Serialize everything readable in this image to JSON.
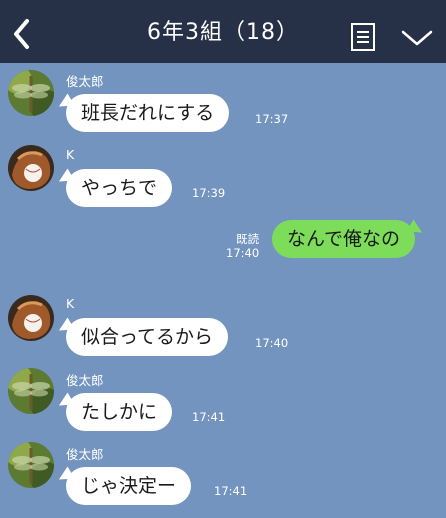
{
  "header": {
    "title": "6年3組（18）",
    "back_icon": "chevron-left-icon",
    "menu_icon": "notes-icon",
    "expand_icon": "chevron-down-icon",
    "background": "#263047"
  },
  "chat": {
    "background": "#7494c0",
    "outgoing_color": "#7ddd5a",
    "messages": [
      {
        "sender": "俊太郎",
        "text": "班長だれにする",
        "time": "17:37",
        "avatar": "dragonfly-avatar"
      },
      {
        "sender": "K",
        "text": "やっちで",
        "time": "17:39",
        "avatar": "baseball-glove-avatar"
      },
      {
        "read_label": "既読",
        "text": "なんで俺なの",
        "time": "17:40",
        "outgoing": true
      },
      {
        "sender": "K",
        "text": "似合ってるから",
        "time": "17:40",
        "avatar": "baseball-glove-avatar"
      },
      {
        "sender": "俊太郎",
        "text": "たしかに",
        "time": "17:41",
        "avatar": "dragonfly-avatar"
      },
      {
        "sender": "俊太郎",
        "text": "じゃ決定ー",
        "time": "17:41",
        "avatar": "dragonfly-avatar"
      }
    ]
  }
}
